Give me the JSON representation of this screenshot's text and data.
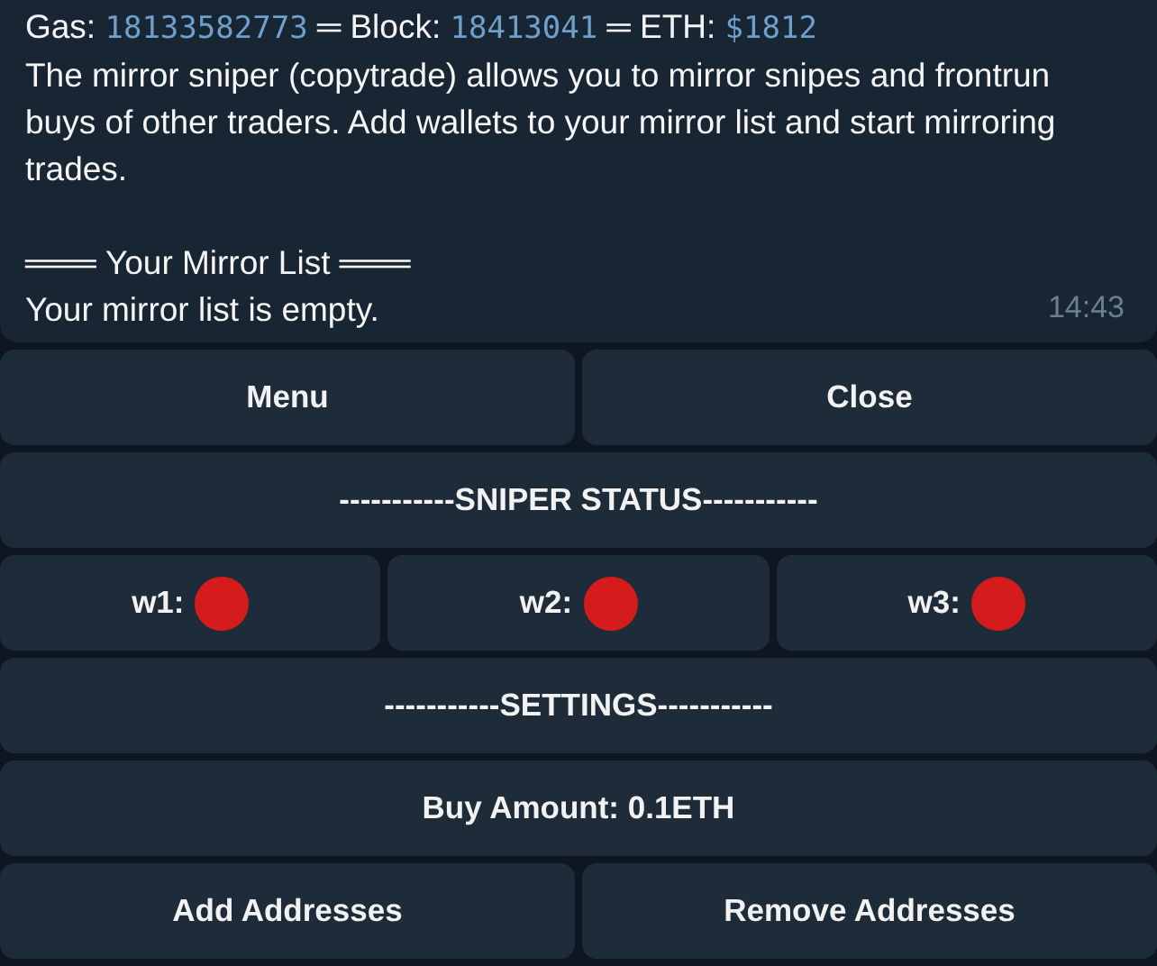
{
  "message": {
    "stats": [
      {
        "label": "Gas:",
        "value": "18133582773"
      },
      {
        "label": "Block:",
        "value": "18413041"
      },
      {
        "label": "ETH:",
        "value": "$1812"
      }
    ],
    "separator": "═",
    "description": "The mirror sniper (copytrade) allows you to mirror snipes and frontrun buys of other traders. Add wallets to your mirror list and start mirroring trades.",
    "section_rule": "═══",
    "section_title": "Your Mirror List",
    "status": "Your mirror list is empty.",
    "time": "14:43"
  },
  "keyboard": [
    [
      {
        "label": "Menu"
      },
      {
        "label": "Close"
      }
    ],
    [
      {
        "label": "-----------SNIPER STATUS-----------"
      }
    ],
    [
      {
        "label": "w1:",
        "color": "#d51c1c"
      },
      {
        "label": "w2:",
        "color": "#d51c1c"
      },
      {
        "label": "w3:",
        "color": "#d51c1c"
      }
    ],
    [
      {
        "label": "-----------SETTINGS-----------"
      }
    ],
    [
      {
        "label": "Buy Amount: 0.1ETH"
      }
    ],
    [
      {
        "label": "Add Addresses"
      },
      {
        "label": "Remove Addresses"
      }
    ]
  ]
}
